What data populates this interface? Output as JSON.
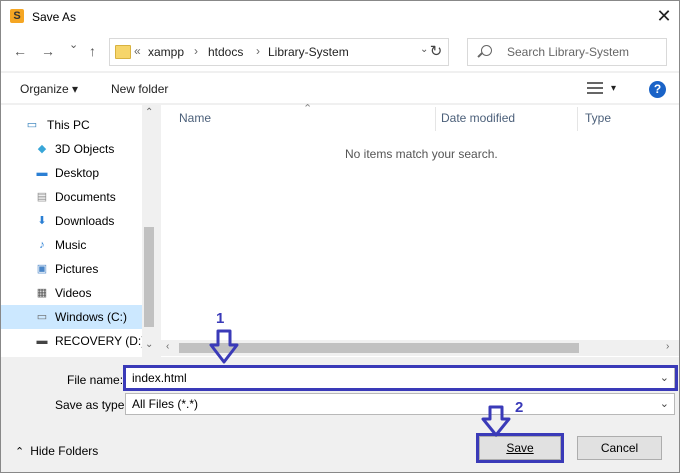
{
  "window": {
    "title": "Save As",
    "app_icon": "sublime-icon",
    "close_glyph": "✕"
  },
  "nav": {
    "back": "←",
    "forward": "→",
    "recent": "⌄",
    "up": "↑"
  },
  "address": {
    "prefix": "«",
    "crumbs": [
      "xampp",
      "htdocs",
      "Library-System"
    ],
    "separator": "›",
    "dropdown": "⌄",
    "refresh": "↻"
  },
  "search": {
    "placeholder": "Search Library-System"
  },
  "toolbar": {
    "organize": "Organize ▾",
    "new_folder": "New folder",
    "views_dropdown": "▾",
    "help": "?"
  },
  "tree": [
    {
      "label": "This PC",
      "icon": "pc-icon",
      "glyph": "▭",
      "color": "#2a7ab8"
    },
    {
      "label": "3D Objects",
      "icon": "cube-icon",
      "glyph": "◆",
      "color": "#38a6d8"
    },
    {
      "label": "Desktop",
      "icon": "desktop-icon",
      "glyph": "▬",
      "color": "#2b7fd4"
    },
    {
      "label": "Documents",
      "icon": "documents-icon",
      "glyph": "▤",
      "color": "#8a8a8a"
    },
    {
      "label": "Downloads",
      "icon": "download-icon",
      "glyph": "⬇",
      "color": "#2b7fd4"
    },
    {
      "label": "Music",
      "icon": "music-icon",
      "glyph": "♪",
      "color": "#2b7fd4"
    },
    {
      "label": "Pictures",
      "icon": "pictures-icon",
      "glyph": "▣",
      "color": "#4a86c8"
    },
    {
      "label": "Videos",
      "icon": "videos-icon",
      "glyph": "▦",
      "color": "#555555"
    },
    {
      "label": "Windows (C:)",
      "icon": "drive-icon",
      "glyph": "▭",
      "color": "#666666",
      "selected": true
    },
    {
      "label": "RECOVERY (D:)",
      "icon": "drive-icon",
      "glyph": "▬",
      "color": "#444444"
    }
  ],
  "columns": [
    "Name",
    "Date modified",
    "Type"
  ],
  "sort_indicator": "⌃",
  "empty_message": "No items match your search.",
  "scroll": {
    "up": "⌃",
    "down": "⌄",
    "left": "‹",
    "right": "›"
  },
  "file_name": {
    "label": "File name:",
    "value": "index.html",
    "dropdown": "⌄"
  },
  "save_type": {
    "label": "Save as type:",
    "value": "All Files (*.*)",
    "dropdown": "⌄"
  },
  "buttons": {
    "hide_folders": "Hide Folders",
    "hide_chevron": "⌃",
    "save": "Save",
    "cancel": "Cancel"
  },
  "annotations": {
    "step1": "1",
    "step2": "2",
    "color": "#3a3ab8"
  }
}
